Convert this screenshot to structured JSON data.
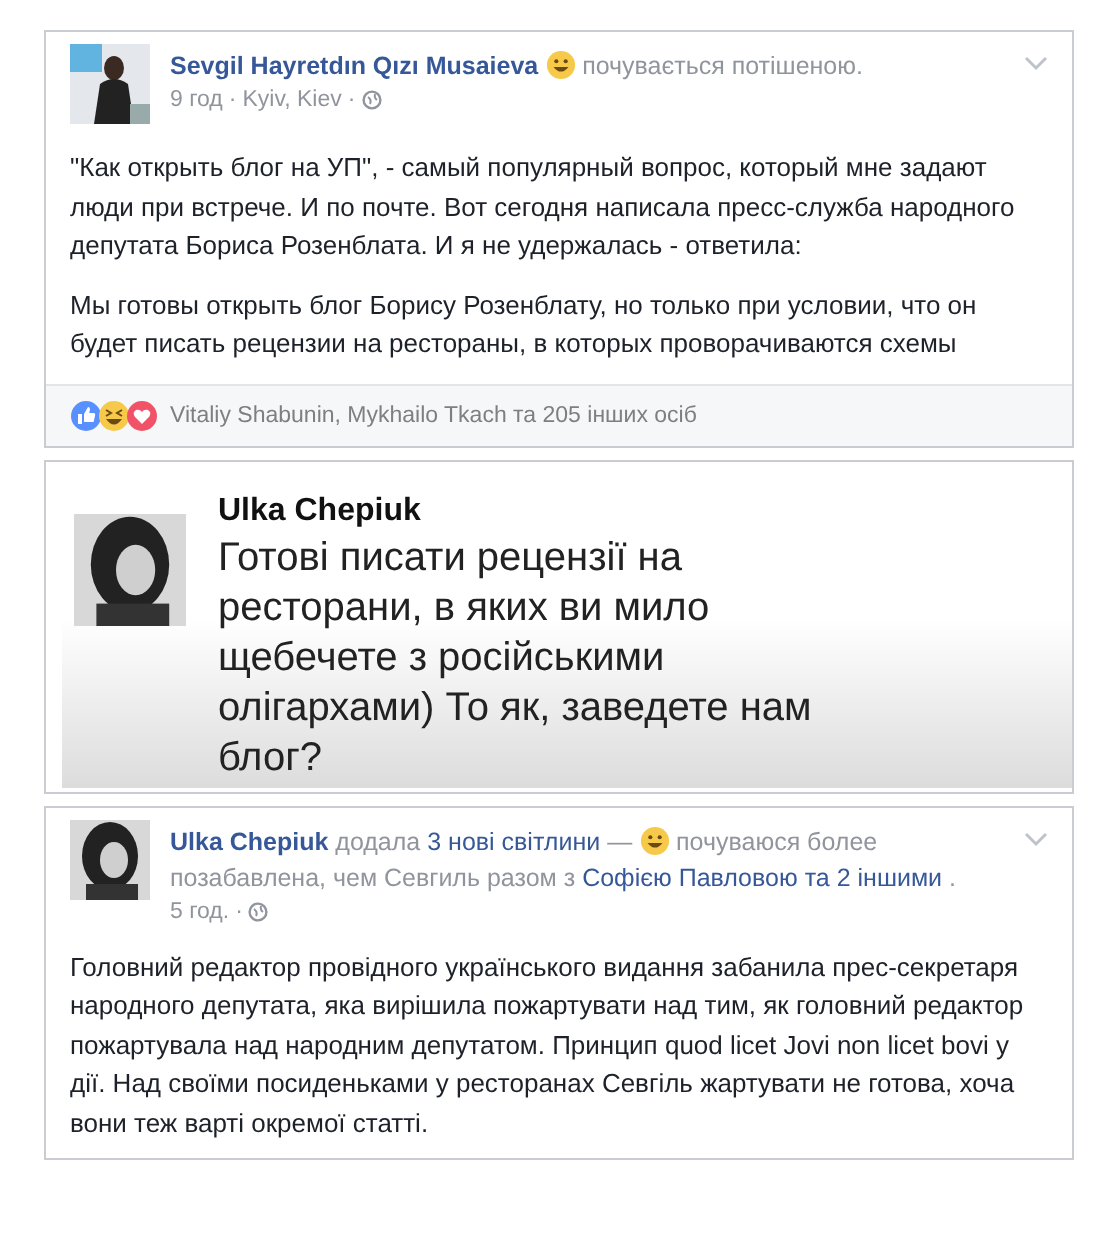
{
  "posts": [
    {
      "kind": "post",
      "author": "Sevgil Hayretdın Qızı Musaieva",
      "header_after": [
        {
          "kind": "plain",
          "text": "почувається потішеною."
        }
      ],
      "meta": [
        "9 год",
        "·",
        "Kyiv, Kiev",
        "·"
      ],
      "paragraphs": [
        "\"Как открыть блог на УП\", - самый популярный вопрос, который мне задают люди при встрече. И по почте. Вот сегодня написала пресс-служба народного депутата Бориса Розенблата. И я не удержалась - ответила:",
        "Мы готовы открыть блог Борису Розенблату, но только при условии, что он будет писать рецензии на рестораны, в которых проворачиваются схемы"
      ],
      "reactions": "Vitaliy Shabunin, Mykhailo Tkach та 205 інших осіб"
    },
    {
      "kind": "quote",
      "author": "Ulka Chepiuk",
      "text": "Готові писати рецензії на ресторани, в яких ви мило щебечете з російськими олігархами) То як, заведете нам блог?"
    },
    {
      "kind": "post",
      "author": "Ulka Chepiuk",
      "header_before": [
        {
          "kind": "plain",
          "text": "додала"
        },
        {
          "kind": "link",
          "text": "3 нові світлини"
        },
        {
          "kind": "plain",
          "text": "—"
        }
      ],
      "header_after": [
        {
          "kind": "plain",
          "text": "почуваюся более позабавлена, чем Севгиль разом з"
        },
        {
          "kind": "link",
          "text": "Софією Павловою"
        },
        {
          "kind": "link",
          "text": "та 2 іншими"
        },
        {
          "kind": "plain",
          "text": "."
        }
      ],
      "meta": [
        "5 год.",
        "·"
      ],
      "paragraphs": [
        "Головний редактор провідного українського видання забанила прес-секретаря народного депутата, яка вирішила пожартувати над тим, як головний редактор пожартувала над народним депутатом. Принцип quod licet Jovi non licet bovi у дії. Над своїми посиденьками у ресторанах Севгіль жартувати не готова, хоча вони теж варті окремої статті."
      ]
    }
  ]
}
